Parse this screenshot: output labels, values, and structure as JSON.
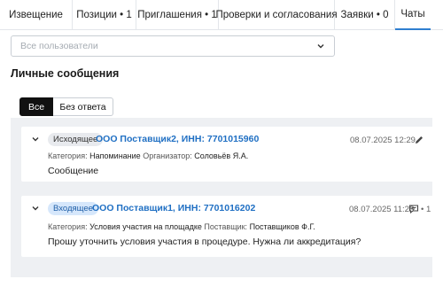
{
  "tabs": [
    {
      "label": "Извещение"
    },
    {
      "label": "Позиции • 1"
    },
    {
      "label": "Приглашения • 1"
    },
    {
      "label": "Проверки и согласования"
    },
    {
      "label": "Заявки • 0"
    },
    {
      "label": "Чаты"
    }
  ],
  "users_select": {
    "placeholder": "Все пользователи"
  },
  "section_title": "Личные сообщения",
  "filters": {
    "all_label": "Все",
    "unanswered_label": "Без ответа"
  },
  "messages": [
    {
      "direction": "Исходящее",
      "org": "ООО Поставщик2, ИНН: 7701015960",
      "datetime": "08.07.2025 12:29",
      "category_label": "Категория:",
      "category": "Напоминание",
      "person_label": "Организатор:",
      "person": "Соловьёв Я.А.",
      "text": "Сообщение"
    },
    {
      "direction": "Входящее",
      "org": "ООО Поставщик1, ИНН: 7701016202",
      "datetime": "08.07.2025 11:28",
      "reply_count": "• 1",
      "category_label": "Категория:",
      "category": "Условия участия на площадке",
      "person_label": "Поставщик:",
      "person": "Поставщиков Ф.Г.",
      "text": "Прошу уточнить условия участия в процедуре. Нужна ли аккредитация?"
    }
  ],
  "colors": {
    "accent": "#2f7fd0",
    "link": "#1f6fc3",
    "incoming_badge": "#d6e7fb",
    "list_bg": "#eef0f3"
  }
}
